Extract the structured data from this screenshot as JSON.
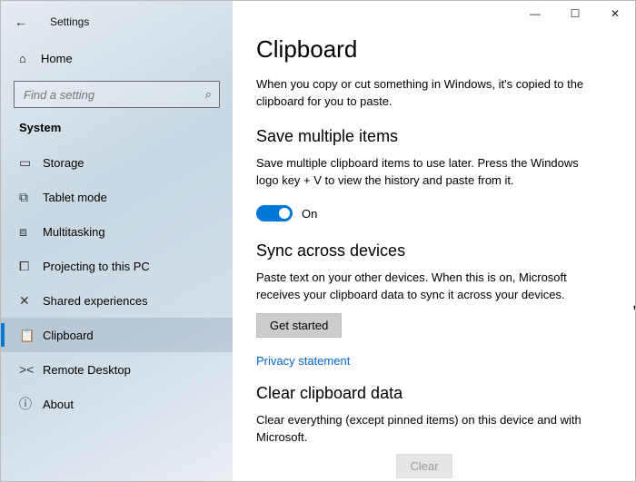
{
  "window": {
    "title": "Settings",
    "minimize": "—",
    "maximize": "☐",
    "close": "✕"
  },
  "sidebar": {
    "home_label": "Home",
    "search_placeholder": "Find a setting",
    "section": "System",
    "items": [
      {
        "icon": "▭",
        "label": "Storage"
      },
      {
        "icon": "⧉",
        "label": "Tablet mode"
      },
      {
        "icon": "⧈",
        "label": "Multitasking"
      },
      {
        "icon": "⧠",
        "label": "Projecting to this PC"
      },
      {
        "icon": "✕",
        "label": "Shared experiences"
      },
      {
        "icon": "📋",
        "label": "Clipboard"
      },
      {
        "icon": "><",
        "label": "Remote Desktop"
      },
      {
        "icon": "ⓘ",
        "label": "About"
      }
    ]
  },
  "page": {
    "heading": "Clipboard",
    "intro": "When you copy or cut something in Windows, it's copied to the clipboard for you to paste.",
    "section1_title": "Save multiple items",
    "section1_desc": "Save multiple clipboard items to use later. Press the Windows logo key + V to view the history and paste from it.",
    "toggle_state": "On",
    "section2_title": "Sync across devices",
    "section2_desc": "Paste text on your other devices. When this is on, Microsoft receives your clipboard data to sync it across your devices.",
    "get_started": "Get started",
    "privacy_link": "Privacy statement",
    "section3_title": "Clear clipboard data",
    "section3_desc": "Clear everything (except pinned items) on this device and with Microsoft.",
    "clear_btn": "Clear"
  }
}
